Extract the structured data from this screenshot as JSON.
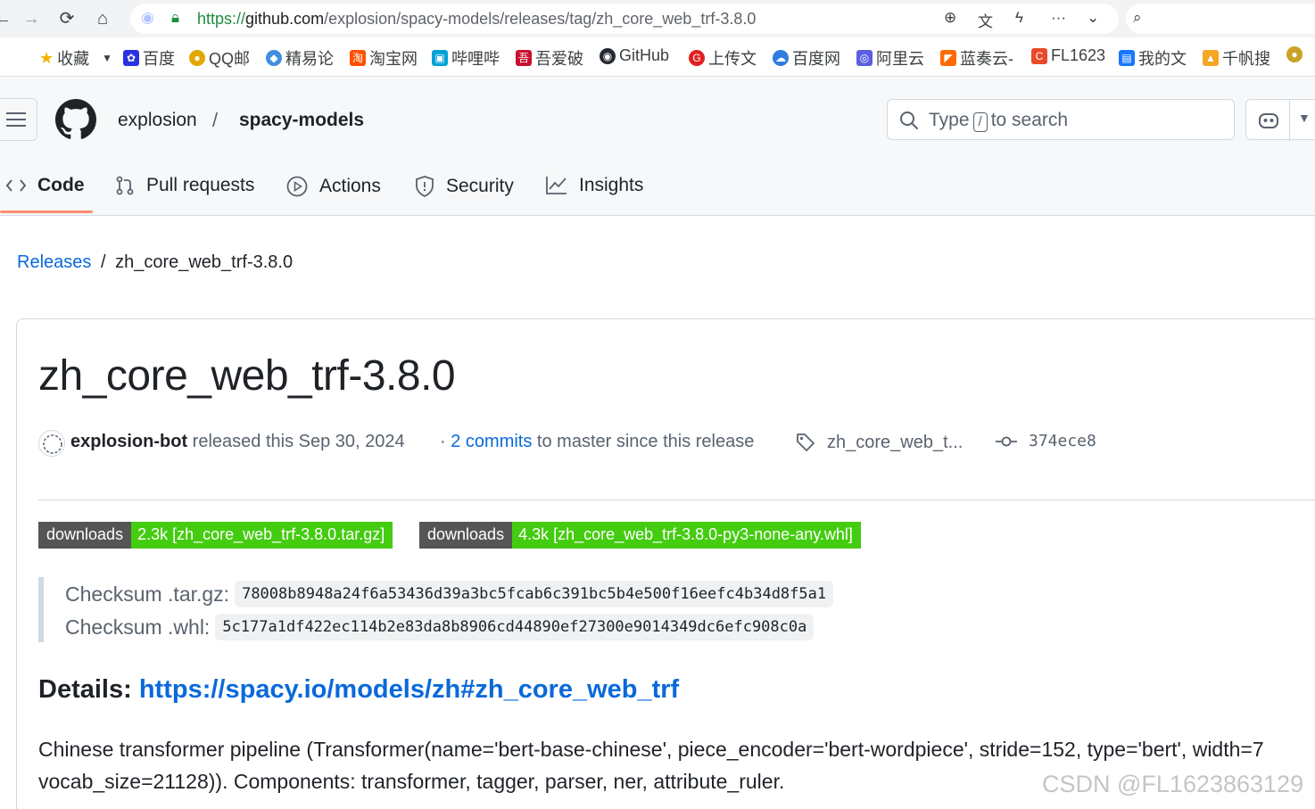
{
  "browser": {
    "url_proto": "https://",
    "url_host": "github.com",
    "url_path": "/explosion/spacy-models/releases/tag/zh_core_web_trf-3.8.0",
    "bookmarks": [
      "收藏",
      "百度",
      "QQ邮",
      "精易论",
      "淘宝网",
      "哔哩哔",
      "吾爱破",
      "GitHub",
      "上传文",
      "百度网",
      "阿里云",
      "蓝奏云-",
      "FL1623",
      "我的文",
      "千帆搜"
    ]
  },
  "header": {
    "owner": "explosion",
    "separator": "/",
    "repo": "spacy-models",
    "search_prefix": "Type",
    "search_key": "/",
    "search_suffix": "to search"
  },
  "tabs": [
    {
      "label": "Code",
      "icon": "code-icon"
    },
    {
      "label": "Pull requests",
      "icon": "git-pull-request-icon"
    },
    {
      "label": "Actions",
      "icon": "play-icon"
    },
    {
      "label": "Security",
      "icon": "shield-icon"
    },
    {
      "label": "Insights",
      "icon": "graph-icon"
    }
  ],
  "breadcrumb": {
    "link": "Releases",
    "separator": "/",
    "current": "zh_core_web_trf-3.8.0"
  },
  "release": {
    "title": "zh_core_web_trf-3.8.0",
    "author": "explosion-bot",
    "released_text": "released this Sep 30, 2024",
    "commits_prefix": "·",
    "commits_link": "2 commits",
    "commits_suffix": "to master since this release",
    "tag": "zh_core_web_t...",
    "commit_sha": "374ece8",
    "badges": [
      {
        "label": "downloads",
        "value": "2.3k [zh_core_web_trf-3.8.0.tar.gz]"
      },
      {
        "label": "downloads",
        "value": "4.3k [zh_core_web_trf-3.8.0-py3-none-any.whl]"
      }
    ],
    "checksums": [
      {
        "label": "Checksum .tar.gz:",
        "value": "78008b8948a24f6a53436d39a3bc5fcab6c391bc5b4e500f16eefc4b34d8f5a1"
      },
      {
        "label": "Checksum .whl:",
        "value": "5c177a1df422ec114b2e83da8b8906cd44890ef27300e9014349dc6efc908c0a"
      }
    ],
    "details_label": "Details:",
    "details_link": "https://spacy.io/models/zh#zh_core_web_trf",
    "description_line1": "Chinese transformer pipeline (Transformer(name='bert-base-chinese', piece_encoder='bert-wordpiece', stride=152, type='bert', width=7",
    "description_line2": "vocab_size=21128)). Components: transformer, tagger, parser, ner, attribute_ruler."
  },
  "watermark": "CSDN @FL1623863129",
  "colors": {
    "link": "#0969da",
    "tab_underline": "#fd8c73",
    "badge_label_bg": "#555555",
    "badge_value_bg": "#44cc11"
  }
}
